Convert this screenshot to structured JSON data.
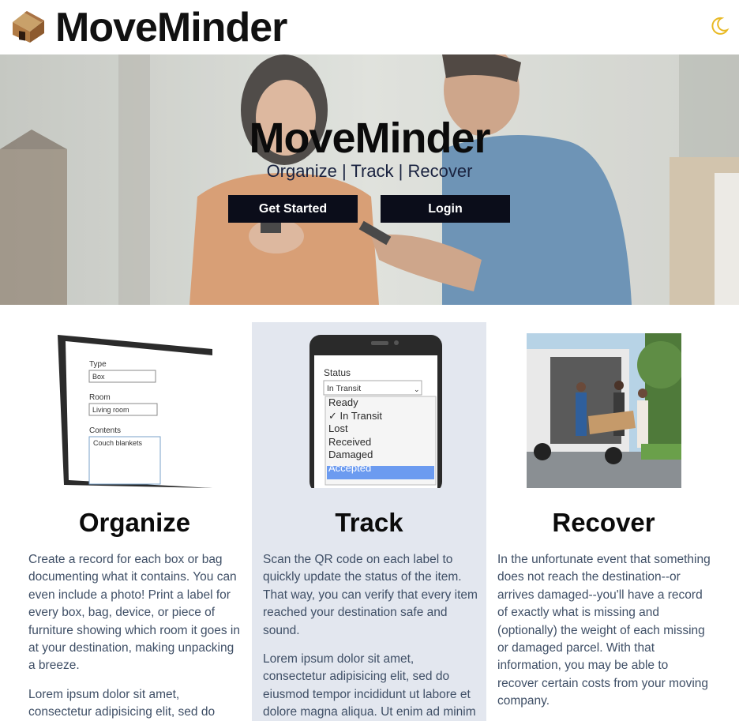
{
  "header": {
    "brand": "MoveMinder",
    "logo_icon": "moving-box-icon",
    "theme_icon": "moon-icon",
    "accent_color": "#e8b923"
  },
  "hero": {
    "title": "MoveMinder",
    "subtitle": "Organize | Track | Recover",
    "buttons": {
      "get_started": "Get Started",
      "login": "Login"
    }
  },
  "features": {
    "organize": {
      "title": "Organize",
      "image": {
        "type_label": "Type",
        "type_value": "Box",
        "room_label": "Room",
        "room_value": "Living room",
        "contents_label": "Contents",
        "contents_value": "Couch blankets"
      },
      "p1": "Create a record for each box or bag documenting what it contains. You can even include a photo! Print a label for every box, bag, device, or piece of furniture showing which room it goes in at your destination, making unpacking a breeze.",
      "p2": "Lorem ipsum dolor sit amet, consectetur adipisicing elit, sed do"
    },
    "track": {
      "title": "Track",
      "image": {
        "status_label": "Status",
        "status_value": "In Transit",
        "options": [
          "Ready",
          "✓ In Transit",
          "Lost",
          "Received",
          "Damaged",
          "Accepted"
        ]
      },
      "p1": "Scan the QR code on each label to quickly update the status of the item. That way, you can verify that every item reached your destination safe and sound.",
      "p2": "Lorem ipsum dolor sit amet, consectetur adipisicing elit, sed do eiusmod tempor incididunt ut labore et dolore magna aliqua. Ut enim ad minim"
    },
    "recover": {
      "title": "Recover",
      "p1": "In the unfortunate event that something does not reach the destination--or arrives damaged--you'll have a record of exactly what is missing and (optionally) the weight of each missing or damaged parcel. With that information, you may be able to recover certain costs from your moving company."
    }
  }
}
